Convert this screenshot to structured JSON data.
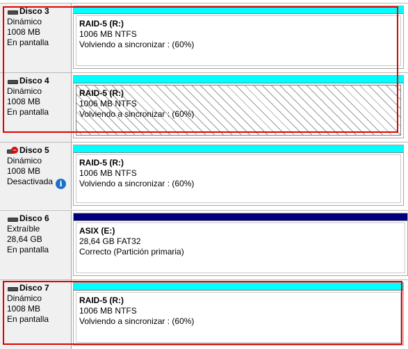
{
  "disks": [
    {
      "id": "disco-3",
      "name": "Disco 3",
      "type": "Dinámico",
      "size": "1008 MB",
      "status": "En pantalla",
      "icon": "disk-icon",
      "volume": {
        "name": "RAID-5  (R:)",
        "detail": "1006 MB NTFS",
        "status": "Volviendo a sincronizar : (60%)",
        "header_color": "#00ffff",
        "hatched": false
      }
    },
    {
      "id": "disco-4",
      "name": "Disco 4",
      "type": "Dinámico",
      "size": "1008 MB",
      "status": "En pantalla",
      "icon": "disk-icon",
      "volume": {
        "name": "RAID-5  (R:)",
        "detail": "1006 MB NTFS",
        "status": "Volviendo a sincronizar : (60%)",
        "header_color": "#00ffff",
        "hatched": true
      }
    },
    {
      "id": "disco-5",
      "name": "Disco 5",
      "type": "Dinámico",
      "size": "1008 MB",
      "status": "Desactivada",
      "icon": "disk-offline-icon",
      "status_icon": "info-icon",
      "volume": {
        "name": "RAID-5  (R:)",
        "detail": "1006 MB NTFS",
        "status": "Volviendo a sincronizar : (60%)",
        "header_color": "#00ffff",
        "hatched": false
      }
    },
    {
      "id": "disco-6",
      "name": "Disco 6",
      "type": "Extraíble",
      "size": "28,64 GB",
      "status": "En pantalla",
      "icon": "disk-icon",
      "volume": {
        "name": "ASIX  (E:)",
        "detail": "28,64 GB FAT32",
        "status": "Correcto (Partición primaria)",
        "header_color": "#00007f",
        "hatched": false
      }
    },
    {
      "id": "disco-7",
      "name": "Disco 7",
      "type": "Dinámico",
      "size": "1008 MB",
      "status": "En pantalla",
      "icon": "disk-icon",
      "volume": {
        "name": "RAID-5  (R:)",
        "detail": "1006 MB NTFS",
        "status": "Volviendo a sincronizar : (60%)",
        "header_color": "#00ffff",
        "hatched": false
      }
    }
  ],
  "highlight_color": "#e00000"
}
